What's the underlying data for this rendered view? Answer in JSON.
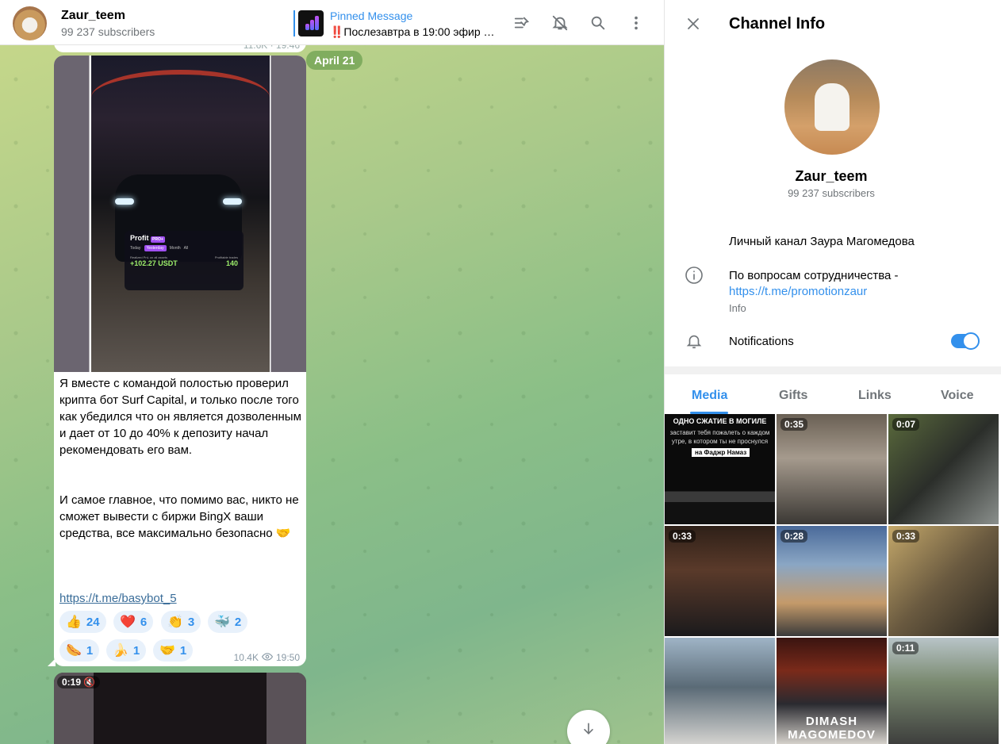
{
  "chat": {
    "channel_name": "Zaur_teem",
    "subscribers": "99 237 subscribers",
    "pinned": {
      "label": "Pinned Message",
      "text": "‼️Послезавтра в 19:00 эфир …"
    },
    "date_chip": "April 21",
    "previous_message_meta": "11.6K · 19:46",
    "message": {
      "profit_card": {
        "title": "Profit",
        "badge": "PRO+",
        "tabs": [
          "Today",
          "Yesterday",
          "Month",
          "All"
        ],
        "selected_tab": "Yesterday",
        "left_label": "Realized PnL on all assets",
        "right_label": "Profitable trades",
        "pnl": "+102.27 USDT",
        "trades": "140"
      },
      "text": "Я вместе с командой полостью проверил крипта бот Surf Capital, и только после того как убедился что он является дозволенным и дает от 10 до 40% к депозиту начал рекомендовать его вам.\n\n\nИ самое главное, что помимо вас, никто не сможет вывести с биржи BingX ваши средства, все максимально безопасно 🤝",
      "link": "https://t.me/basybot_5",
      "reactions": [
        {
          "emoji": "👍",
          "count": "24"
        },
        {
          "emoji": "❤️",
          "count": "6"
        },
        {
          "emoji": "👏",
          "count": "3"
        },
        {
          "emoji": "🐳",
          "count": "2"
        },
        {
          "emoji": "🌭",
          "count": "1"
        },
        {
          "emoji": "🍌",
          "count": "1"
        },
        {
          "emoji": "🤝",
          "count": "1"
        }
      ],
      "views": "10.4K",
      "time": "19:50"
    },
    "next_message_duration": "0:19"
  },
  "info": {
    "title": "Channel Info",
    "name": "Zaur_teem",
    "subscribers": "99 237 subscribers",
    "bio": "Личный канал Заура Магомедова",
    "description_prefix": "По вопросам сотрудничества -",
    "description_link": "https://t.me/promotionzaur",
    "description_caption": "Info",
    "notifications_label": "Notifications",
    "notifications_on": true,
    "tabs": [
      "Media",
      "Gifts",
      "Links",
      "Voice"
    ],
    "active_tab": "Media",
    "media": [
      {
        "duration": "",
        "caption_title": "ОДНО СЖАТИЕ В МОГИЛЕ",
        "caption_text": "заставит тебя пожалеть о каждом утре, в котором ты не проснулся",
        "caption_tag": "на Фаджр Намаз"
      },
      {
        "duration": "0:35"
      },
      {
        "duration": "0:07"
      },
      {
        "duration": "0:33"
      },
      {
        "duration": "0:28"
      },
      {
        "duration": "0:33"
      },
      {
        "duration": ""
      },
      {
        "duration": "",
        "caption_bottom": "DIMASH MAGOMEDOV"
      },
      {
        "duration": "0:11"
      }
    ]
  },
  "colors": {
    "accent": "#3390ec",
    "secondary_text": "#707579",
    "link": "#3a6d99"
  }
}
